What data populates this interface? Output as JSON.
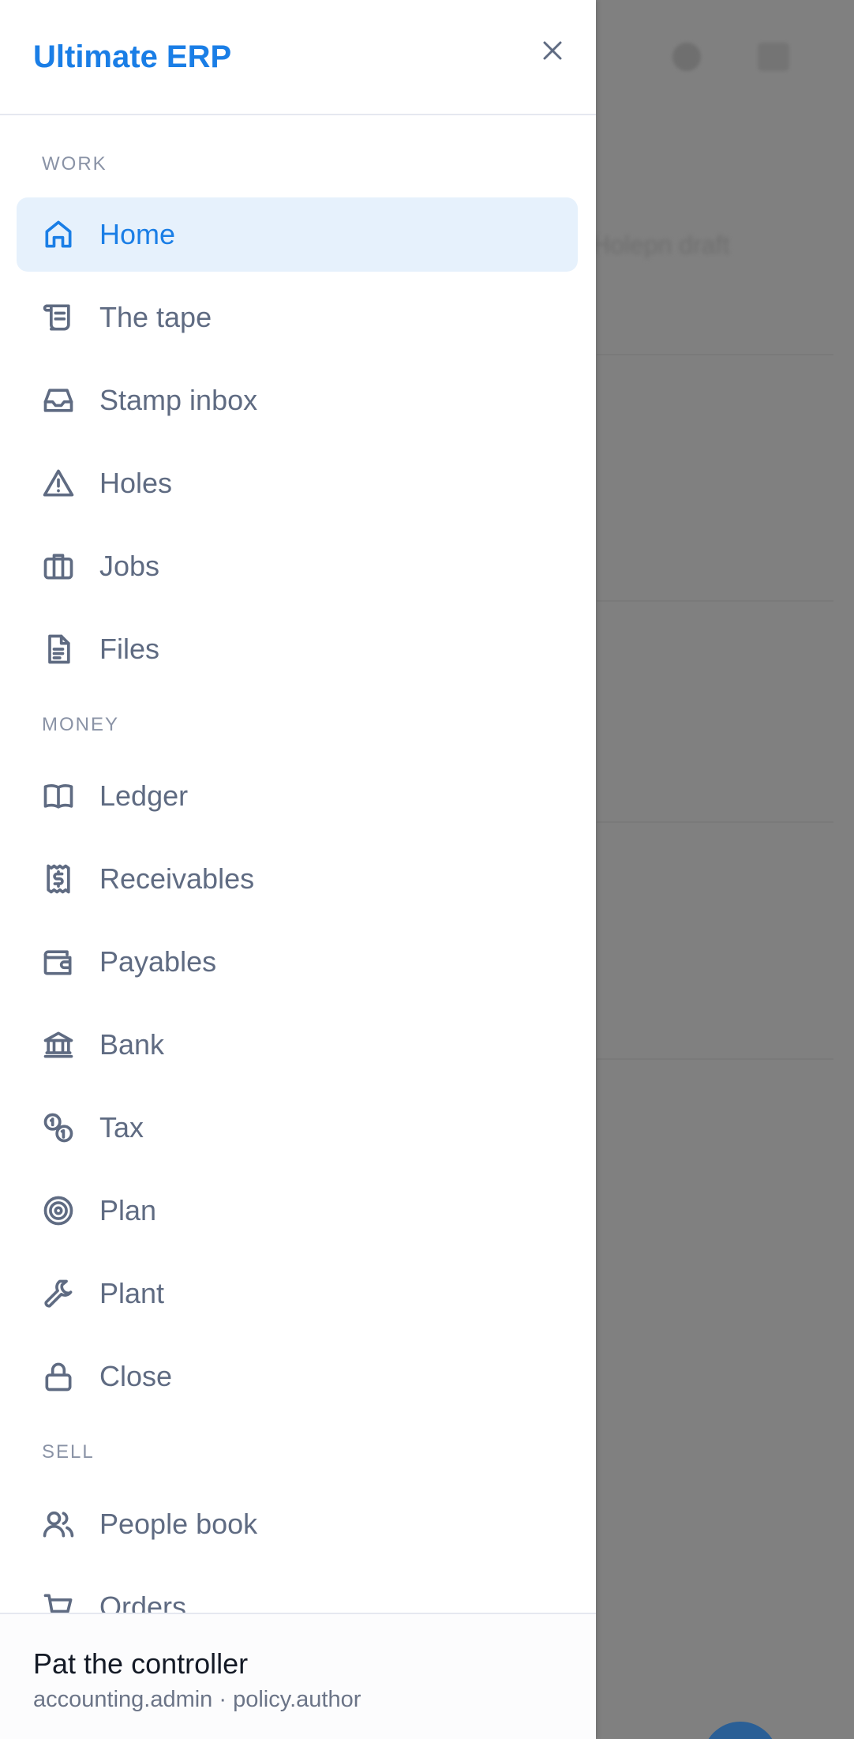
{
  "app": {
    "title": "Ultimate ERP"
  },
  "background": {
    "partial_text": "Holepn draft"
  },
  "sections": {
    "work": "WORK",
    "money": "MONEY",
    "sell": "SELL"
  },
  "nav": {
    "active": "Home",
    "items": [
      {
        "label": "Home",
        "icon": "home-icon"
      },
      {
        "label": "The tape",
        "icon": "scroll-icon"
      },
      {
        "label": "Stamp inbox",
        "icon": "inbox-icon"
      },
      {
        "label": "Holes",
        "icon": "alert-triangle-icon"
      },
      {
        "label": "Jobs",
        "icon": "briefcase-icon"
      },
      {
        "label": "Files",
        "icon": "file-text-icon"
      },
      {
        "label": "Ledger",
        "icon": "book-open-icon"
      },
      {
        "label": "Receivables",
        "icon": "receipt-icon"
      },
      {
        "label": "Payables",
        "icon": "wallet-icon"
      },
      {
        "label": "Bank",
        "icon": "bank-icon"
      },
      {
        "label": "Tax",
        "icon": "coins-icon"
      },
      {
        "label": "Plan",
        "icon": "target-icon"
      },
      {
        "label": "Plant",
        "icon": "wrench-icon"
      },
      {
        "label": "Close",
        "icon": "lock-icon"
      },
      {
        "label": "People book",
        "icon": "users-icon"
      },
      {
        "label": "Orders",
        "icon": "cart-icon"
      }
    ]
  },
  "user": {
    "name": "Pat the controller",
    "roles": "accounting.admin · policy.author"
  },
  "colors": {
    "accent": "#1a7ee6",
    "active_bg": "#e6f1fc",
    "text_muted": "#5f6b82",
    "overlay": "#808080"
  }
}
